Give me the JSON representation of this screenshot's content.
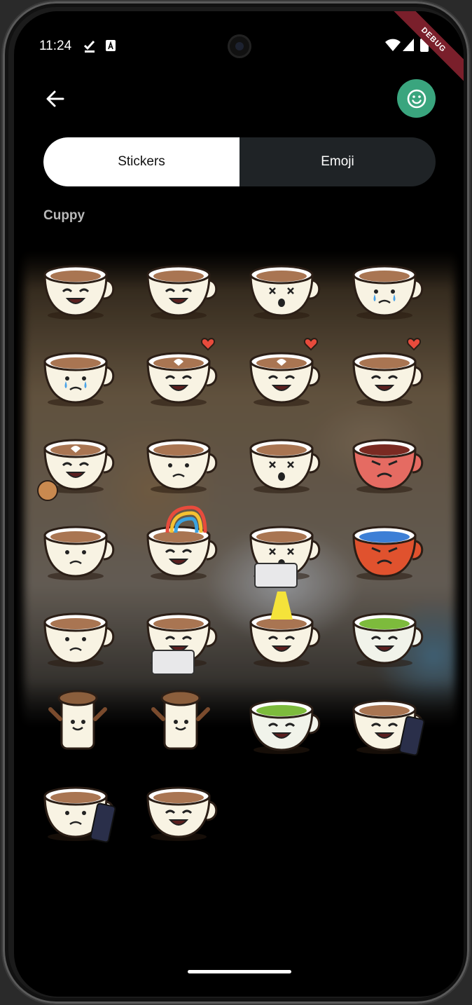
{
  "status_bar": {
    "time": "11:24",
    "debug_label": "DEBUG"
  },
  "header": {
    "back_icon": "arrow-left-icon",
    "emoji_icon": "smiley-icon",
    "accent": "#3aa57e"
  },
  "tabs": [
    {
      "label": "Stickers",
      "selected": true
    },
    {
      "label": "Emoji",
      "selected": false
    }
  ],
  "section_title": "Cuppy",
  "sticker_pack": {
    "name": "Cuppy",
    "stickers": [
      "cup-happy",
      "cup-laughing",
      "cup-dizzy-tilt",
      "cup-crying-spill",
      "cup-melting-cry",
      "cup-latte-hearts",
      "cup-broken-heart-latte",
      "cups-couple-heart",
      "cup-latte-cookie",
      "cup-sad-steam",
      "cup-splash-dizzy",
      "cup-angry-red",
      "cup-confused",
      "cup-rainbow",
      "cup-laptop-error",
      "mug-angry-orange",
      "cup-low-battery",
      "cup-laptop-night",
      "cup-spotlight",
      "bowl-sick-green",
      "paper-cup-wave",
      "paper-cup-dance",
      "matcha-bowl",
      "cup-phone",
      "cup-phone-low-battery",
      "cup-laughing-2"
    ]
  }
}
